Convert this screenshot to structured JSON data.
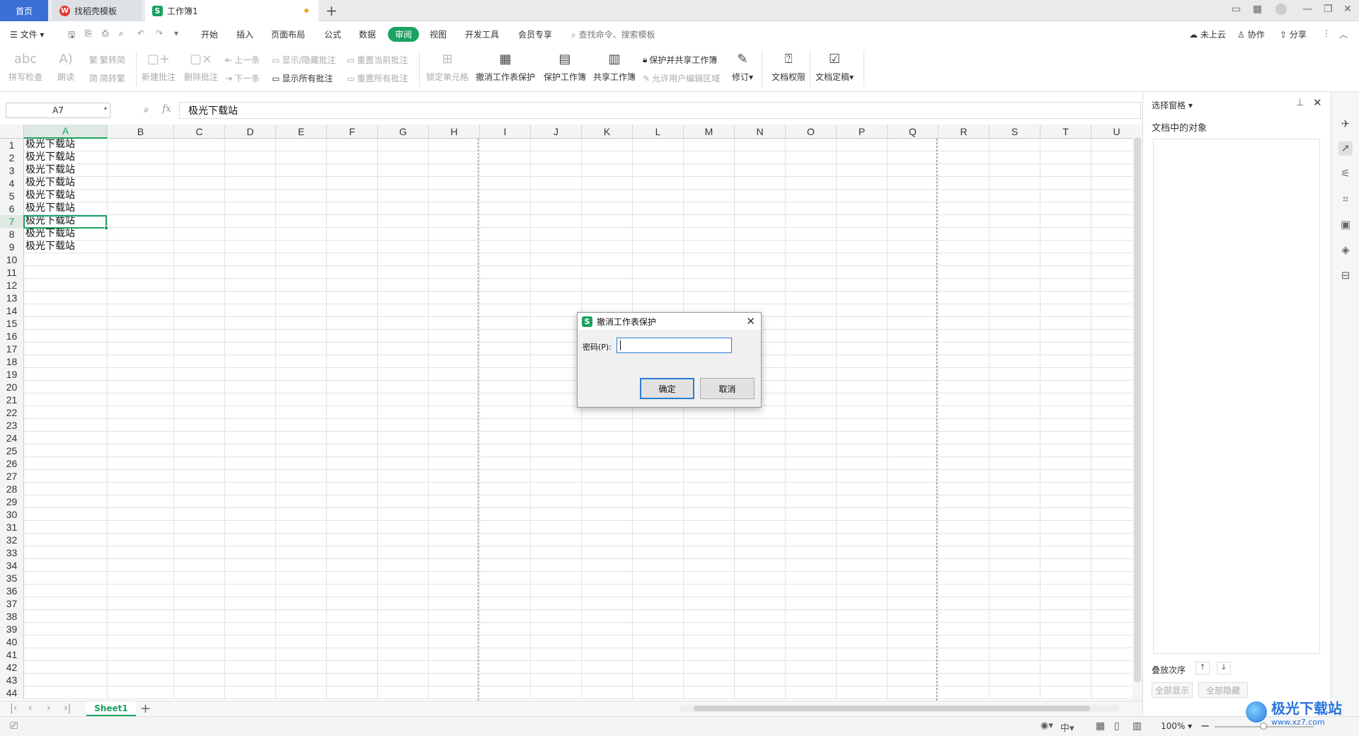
{
  "tabs": {
    "home": "首页",
    "templates": "找稻壳模板",
    "workbook": "工作簿1"
  },
  "menu": {
    "file": "文件",
    "items": [
      "开始",
      "插入",
      "页面布局",
      "公式",
      "数据",
      "审阅",
      "视图",
      "开发工具",
      "会员专享"
    ],
    "active": "审阅",
    "search_placeholder": "查找命令、搜索模板",
    "cloud": "未上云",
    "collab": "协作",
    "share": "分享"
  },
  "ribbon": {
    "spell_check": "拼写检查",
    "read_aloud": "朗读",
    "trad_to_simp": "繁转简",
    "simp_to_trad": "简转繁",
    "new_comment": "新建批注",
    "delete_comment": "删除批注",
    "prev": "上一条",
    "next": "下一条",
    "show_hide_comment": "显示/隐藏批注",
    "show_all_comments": "显示所有批注",
    "reset_current_comment": "重置当前批注",
    "reset_all_comments": "重置所有批注",
    "lock_cells": "锁定单元格",
    "unprotect_sheet": "撤消工作表保护",
    "protect_workbook": "保护工作簿",
    "share_workbook": "共享工作簿",
    "protect_and_share": "保护并共享工作簿",
    "allow_edit_ranges": "允许用户编辑区域",
    "track_changes": "修订",
    "doc_permissions": "文档权限",
    "doc_finalize": "文档定稿"
  },
  "formula": {
    "cell_ref": "A7",
    "fx": "fx",
    "value": "极光下载站"
  },
  "grid": {
    "columns": [
      "A",
      "B",
      "C",
      "D",
      "E",
      "F",
      "G",
      "H",
      "I",
      "J",
      "K",
      "L",
      "M",
      "N",
      "O",
      "P",
      "Q",
      "R",
      "S",
      "T",
      "U"
    ],
    "selected_column": "A",
    "selected_row": 7,
    "row_count": 44,
    "cell_texts": [
      "极光下载站",
      "极光下载站",
      "极光下载站",
      "极光下载站",
      "极光下载站",
      "极光下载站",
      "极光下载站",
      "极光下载站",
      "极光下载站"
    ]
  },
  "sheets": {
    "active": "Sheet1"
  },
  "status": {
    "zoom": "100%"
  },
  "panel": {
    "title": "选择窗格",
    "subtitle": "文档中的对象",
    "stack_order": "叠放次序",
    "show_all": "全部显示",
    "hide_all": "全部隐藏"
  },
  "dialog": {
    "title": "撤消工作表保护",
    "password_label": "密码(P):",
    "password_value": "",
    "ok": "确定",
    "cancel": "取消"
  },
  "watermark": {
    "name": "极光下载站",
    "url": "www.xz7.com"
  }
}
